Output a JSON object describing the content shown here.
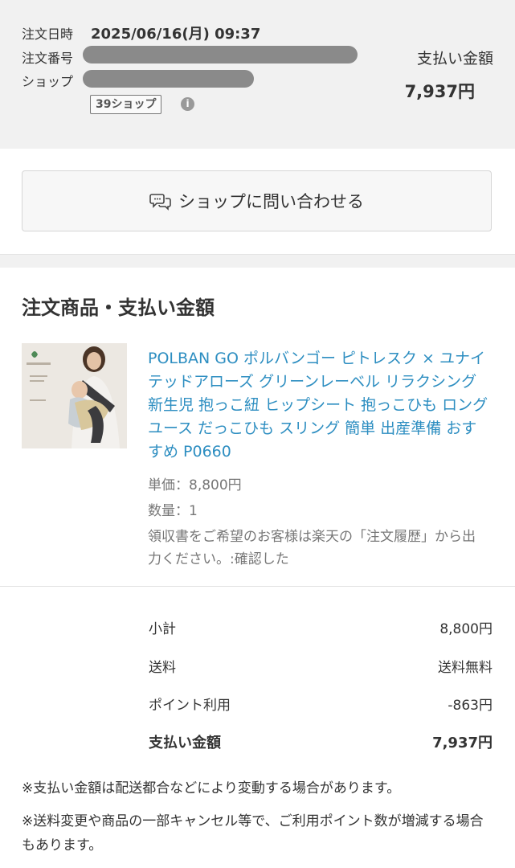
{
  "order": {
    "date_label": "注文日時",
    "date_value": "2025/06/16(月) 09:37",
    "number_label": "注文番号",
    "shop_label": "ショップ",
    "shop_badge": "39ショップ",
    "info_icon": "info-icon",
    "pay_label": "支払い金額",
    "pay_total": "7,937円"
  },
  "contact": {
    "label": "ショップに問い合わせる",
    "icon": "chat-bubbles-icon"
  },
  "section": {
    "title": "注文商品・支払い金額"
  },
  "product": {
    "name": "POLBAN GO ポルバンゴー ピトレスク × ユナイテッドアローズ グリーンレーベル リラクシング 新生児 抱っこ紐 ヒップシート 抱っこひも ロングユース だっこひも スリング 簡単 出産準備 おすすめ P0660",
    "unit_price": "単価：8,800円",
    "quantity": "数量：1",
    "receipt_note": "領収書をご希望のお客様は楽天の「注文履歴」から出力ください。:確認した"
  },
  "summary": {
    "subtotal_label": "小計",
    "subtotal_value": "8,800円",
    "shipping_label": "送料",
    "shipping_value": "送料無料",
    "points_label": "ポイント利用",
    "points_value": "-863円",
    "total_label": "支払い金額",
    "total_value": "7,937円"
  },
  "notes": [
    "※支払い金額は配送都合などにより変動する場合があります。",
    "※送料変更や商品の一部キャンセル等で、ご利用ポイント数が増減する場合もあります。"
  ]
}
